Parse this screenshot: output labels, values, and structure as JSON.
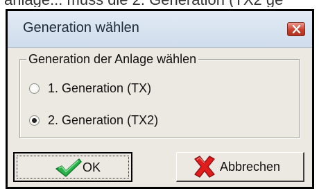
{
  "page": {
    "cropped_caption": "anlage... muss die 2. Generation (TX2 ge"
  },
  "dialog": {
    "title": "Generation wählen",
    "close_icon": "close-x-icon"
  },
  "group": {
    "legend": "Generation der Anlage wählen",
    "options": [
      {
        "label": "1. Generation (TX)",
        "checked": false
      },
      {
        "label": "2. Generation (TX2)",
        "checked": true
      }
    ]
  },
  "buttons": {
    "ok": {
      "label": "OK",
      "icon": "green-checkmark-icon"
    },
    "cancel": {
      "label": "Abbrechen",
      "icon": "red-x-icon"
    }
  },
  "colors": {
    "title_gradient_top": "#e2ebf5",
    "title_gradient_bottom": "#cfdcec",
    "close_button": "#c9412f",
    "dialog_face": "#ece9e2",
    "check_green": "#2bb24a",
    "cancel_red": "#e11c1c"
  }
}
